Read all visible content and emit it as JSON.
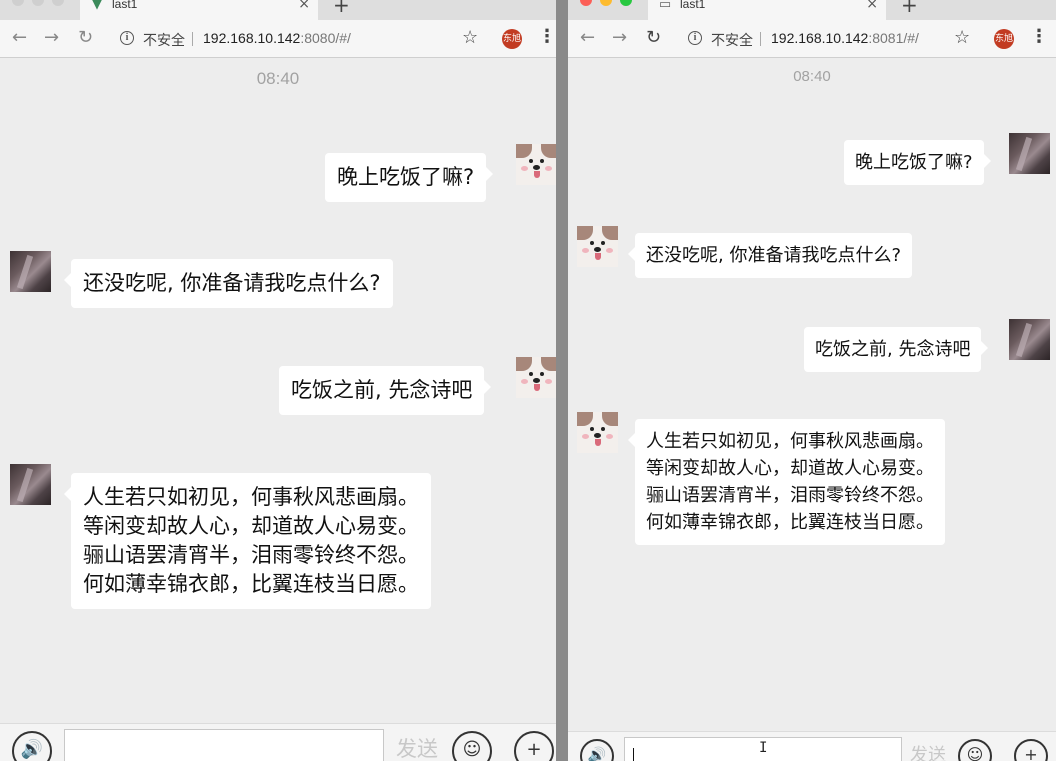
{
  "left": {
    "tab_title": "last1",
    "insecure": "不安全",
    "url_host": "192.168.10.142",
    "url_port": ":8080/#/",
    "profile": "东旭",
    "time": "08:40",
    "messages": [
      {
        "text": "晚上吃饭了嘛?"
      },
      {
        "text": "还没吃呢, 你准备请我吃点什么?"
      },
      {
        "text": "吃饭之前, 先念诗吧"
      },
      {
        "text": "人生若只如初见，何事秋风悲画扇。\n等闲变却故人心，却道故人心易变。\n骊山语罢清宵半，泪雨零铃终不怨。\n何如薄幸锦衣郎，比翼连枝当日愿。"
      }
    ],
    "send": "发送"
  },
  "right": {
    "tab_title": "last1",
    "insecure": "不安全",
    "url_host": "192.168.10.142",
    "url_port": ":8081/#/",
    "profile": "东旭",
    "time": "08:40",
    "messages": [
      {
        "text": "晚上吃饭了嘛?"
      },
      {
        "text": "还没吃呢, 你准备请我吃点什么?"
      },
      {
        "text": "吃饭之前, 先念诗吧"
      },
      {
        "text": "人生若只如初见，何事秋风悲画扇。\n等闲变却故人心，却道故人心易变。\n骊山语罢清宵半，泪雨零铃终不怨。\n何如薄幸锦衣郎，比翼连枝当日愿。"
      }
    ],
    "send": "发送"
  },
  "icons": {
    "back": "←",
    "forward": "→",
    "reload": "↻",
    "info": "i",
    "star": "☆",
    "menu": "⋮",
    "close": "×",
    "newtab": "+",
    "voice": "🔊",
    "emoji": "☺",
    "plus": "+"
  },
  "colors": {
    "chat_bg": "#ededed",
    "bubble": "#ffffff",
    "time": "#a2a2a2",
    "send_disabled": "#c8c8c8",
    "profile_chip": "#c23b22"
  }
}
